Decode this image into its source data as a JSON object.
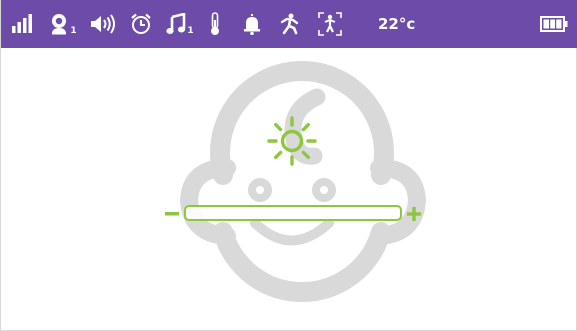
{
  "status_bar": {
    "icons": [
      {
        "name": "signal-strength-icon"
      },
      {
        "name": "camera-user-icon",
        "subscript": "1"
      },
      {
        "name": "volume-icon"
      },
      {
        "name": "alarm-clock-icon"
      },
      {
        "name": "music-note-icon",
        "subscript": "1"
      },
      {
        "name": "thermometer-icon"
      },
      {
        "name": "bell-icon"
      },
      {
        "name": "motion-icon"
      },
      {
        "name": "person-detect-icon"
      }
    ],
    "temperature": "22°c",
    "battery": {
      "name": "battery-icon",
      "level": 1.0
    }
  },
  "main": {
    "background_icon": "baby-face-icon",
    "brightness_icon": "sun-brightness-icon",
    "brightness_level": 0.0,
    "slider_minus": "minus-icon",
    "slider_plus": "plus-icon"
  },
  "colors": {
    "status_bar_bg": "#6c4ca8",
    "accent_green": "#8dc63f",
    "face_gray": "#d9d9d9"
  }
}
